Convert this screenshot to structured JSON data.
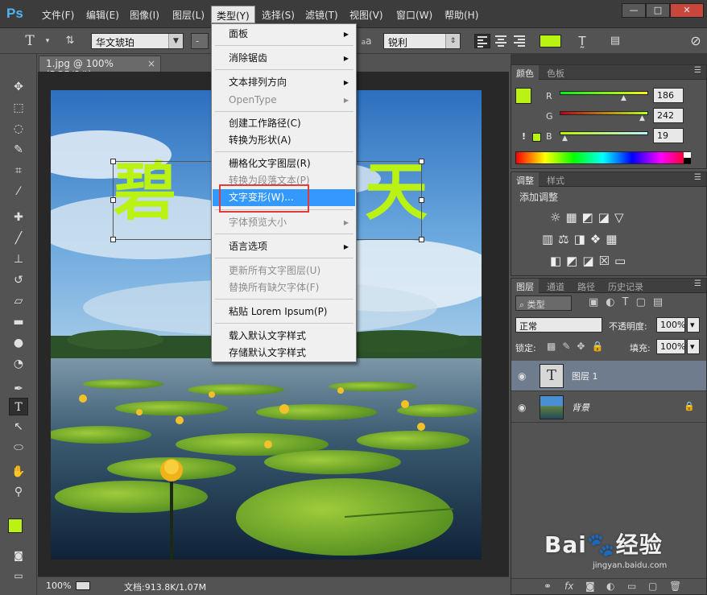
{
  "app": {
    "logo": "Ps"
  },
  "menubar": {
    "items": [
      "文件(F)",
      "编辑(E)",
      "图像(I)",
      "图层(L)",
      "类型(Y)",
      "选择(S)",
      "滤镜(T)",
      "视图(V)",
      "窗口(W)",
      "帮助(H)"
    ],
    "active": "类型(Y)"
  },
  "window_controls": {
    "minimize": "—",
    "maximize": "□",
    "close": "✕"
  },
  "options": {
    "font_family": "华文琥珀",
    "font_style": "-",
    "aa_label": "a",
    "antialias": "锐利",
    "text_color": "#baf213"
  },
  "document": {
    "tab_title": "1.jpg @ 100%(RGB/8#)",
    "tab_close": "×",
    "canvas_text_visible": [
      "碧",
      "天"
    ],
    "zoom": "100%",
    "doc_info": "文档:913.8K/1.07M"
  },
  "dropdown": {
    "items": [
      {
        "label": "面板",
        "submenu": true,
        "disabled": false
      },
      {
        "label": "消除锯齿",
        "submenu": true,
        "disabled": false
      },
      {
        "label": "文本排列方向",
        "submenu": true,
        "disabled": false
      },
      {
        "label": "OpenType",
        "submenu": true,
        "disabled": true
      },
      {
        "label": "创建工作路径(C)",
        "submenu": false,
        "disabled": false
      },
      {
        "label": "转换为形状(A)",
        "submenu": false,
        "disabled": false
      },
      {
        "label": "栅格化文字图层(R)",
        "submenu": false,
        "disabled": false
      },
      {
        "label": "转换为段落文本(P)",
        "submenu": false,
        "disabled": true
      },
      {
        "label": "文字变形(W)...",
        "submenu": false,
        "disabled": false,
        "highlighted": true
      },
      {
        "label": "字体预览大小",
        "submenu": true,
        "disabled": true
      },
      {
        "label": "语言选项",
        "submenu": true,
        "disabled": false
      },
      {
        "label": "更新所有文字图层(U)",
        "submenu": false,
        "disabled": true
      },
      {
        "label": "替换所有缺欠字体(F)",
        "submenu": false,
        "disabled": true
      },
      {
        "label": "粘贴 Lorem Ipsum(P)",
        "submenu": false,
        "disabled": false
      },
      {
        "label": "载入默认文字样式",
        "submenu": false,
        "disabled": false
      },
      {
        "label": "存储默认文字样式",
        "submenu": false,
        "disabled": false
      }
    ],
    "submenu_arrow": "▶"
  },
  "color_panel": {
    "tabs": [
      "颜色",
      "色板"
    ],
    "channels": [
      {
        "label": "R",
        "value": "186"
      },
      {
        "label": "G",
        "value": "242"
      },
      {
        "label": "B",
        "value": "19"
      }
    ],
    "fg_color": "#baf213",
    "warning": "!"
  },
  "adjust_panel": {
    "tabs": [
      "调整",
      "样式"
    ],
    "title": "添加调整"
  },
  "layers_panel": {
    "tabs": [
      "图层",
      "通道",
      "路径",
      "历史记录"
    ],
    "filter_kind": "类型",
    "blend_mode": "正常",
    "opacity_label": "不透明度:",
    "opacity": "100%",
    "lock_label": "锁定:",
    "fill_label": "填充:",
    "fill": "100%",
    "layers": [
      {
        "name": "图层 1",
        "type": "text",
        "selected": true
      },
      {
        "name": "背景",
        "type": "image",
        "selected": false,
        "locked": true
      }
    ],
    "footer_fx": "fx"
  },
  "watermark": {
    "brand": "Bai",
    "suffix": "经验",
    "url": "jingyan.baidu.com"
  }
}
